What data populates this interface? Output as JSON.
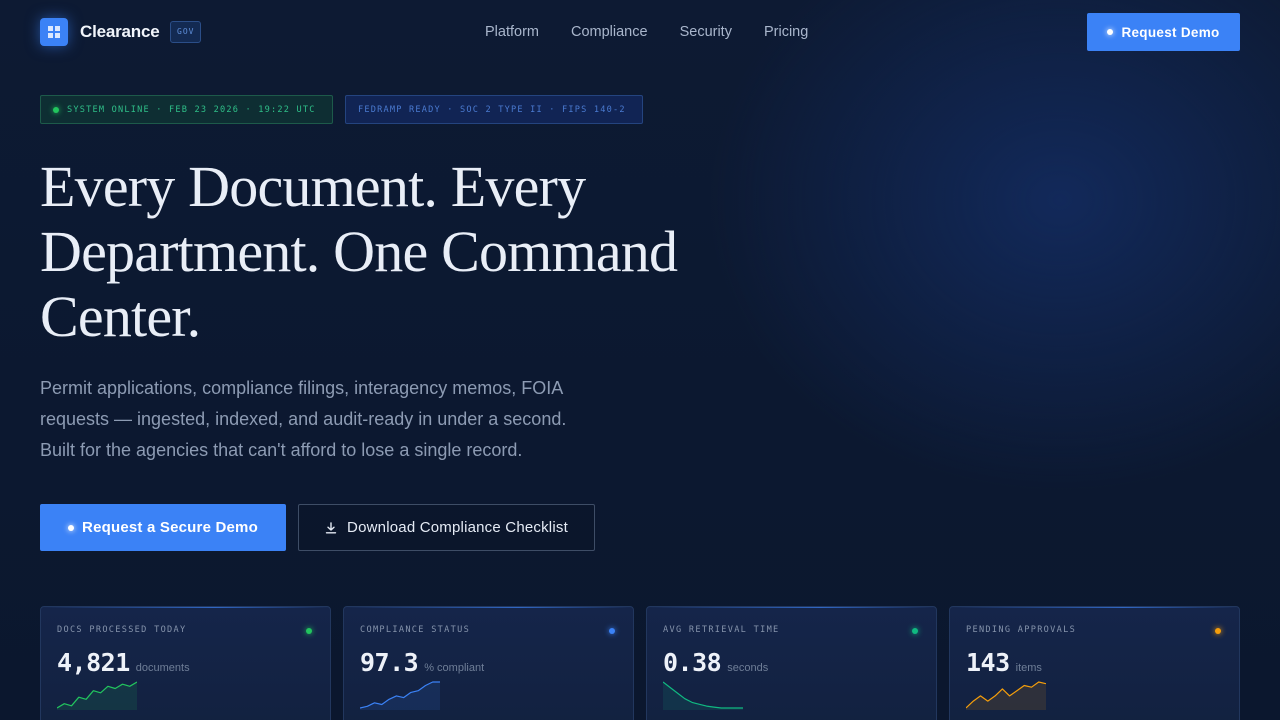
{
  "nav": {
    "brand": "Clearance",
    "badge": "GOV",
    "links": [
      "Platform",
      "Compliance",
      "Security",
      "Pricing"
    ],
    "cta": "Request Demo"
  },
  "status": {
    "system": "SYSTEM ONLINE · FEB 23 2026 · 19:22 UTC",
    "certs": "FEDRAMP READY · SOC 2 TYPE II · FIPS 140-2"
  },
  "hero": {
    "headline": "Every Document. Every Department. One Command Center.",
    "subtext": "Permit applications, compliance filings, interagency memos, FOIA requests — ingested, indexed, and audit-ready in under a second. Built for the agencies that can't afford to lose a single record.",
    "primary_cta": "Request a Secure Demo",
    "secondary_cta": "Download Compliance Checklist"
  },
  "stats": [
    {
      "label": "DOCS PROCESSED TODAY",
      "value": "4,821",
      "unit": "documents",
      "color": "#22c55e",
      "trend": [
        2,
        4,
        3,
        7,
        6,
        10,
        9,
        12,
        11,
        13,
        12,
        14
      ]
    },
    {
      "label": "COMPLIANCE STATUS",
      "value": "97.3",
      "unit": "% compliant",
      "color": "#3b82f6",
      "trend": [
        2,
        3,
        5,
        4,
        7,
        9,
        8,
        11,
        12,
        15,
        17,
        17
      ]
    },
    {
      "label": "AVG RETRIEVAL TIME",
      "value": "0.38",
      "unit": "seconds",
      "color": "#10b981",
      "trend": [
        15,
        12,
        9,
        6,
        4,
        3,
        2,
        1.5,
        1,
        1,
        1,
        1
      ]
    },
    {
      "label": "PENDING APPROVALS",
      "value": "143",
      "unit": "items",
      "color": "#f59e0b",
      "trend": [
        3,
        7,
        10,
        7,
        10,
        14,
        10,
        13,
        16,
        15,
        18,
        17
      ]
    }
  ]
}
